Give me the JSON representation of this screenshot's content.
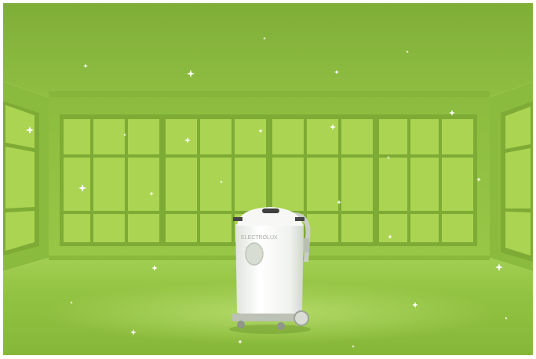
{
  "scene": {
    "description_name": "green-empty-room",
    "colors": {
      "ceiling": "#86b33c",
      "wall": "#8fbe40",
      "window_pane": "#a9d24f",
      "window_frame": "#7fae36",
      "floor": "#92c23e",
      "floor_highlight": "#a8d458",
      "sparkle": "#ffffff"
    }
  },
  "device": {
    "brand_text": "ELECTROLUX",
    "color": "#f3f5f2"
  }
}
